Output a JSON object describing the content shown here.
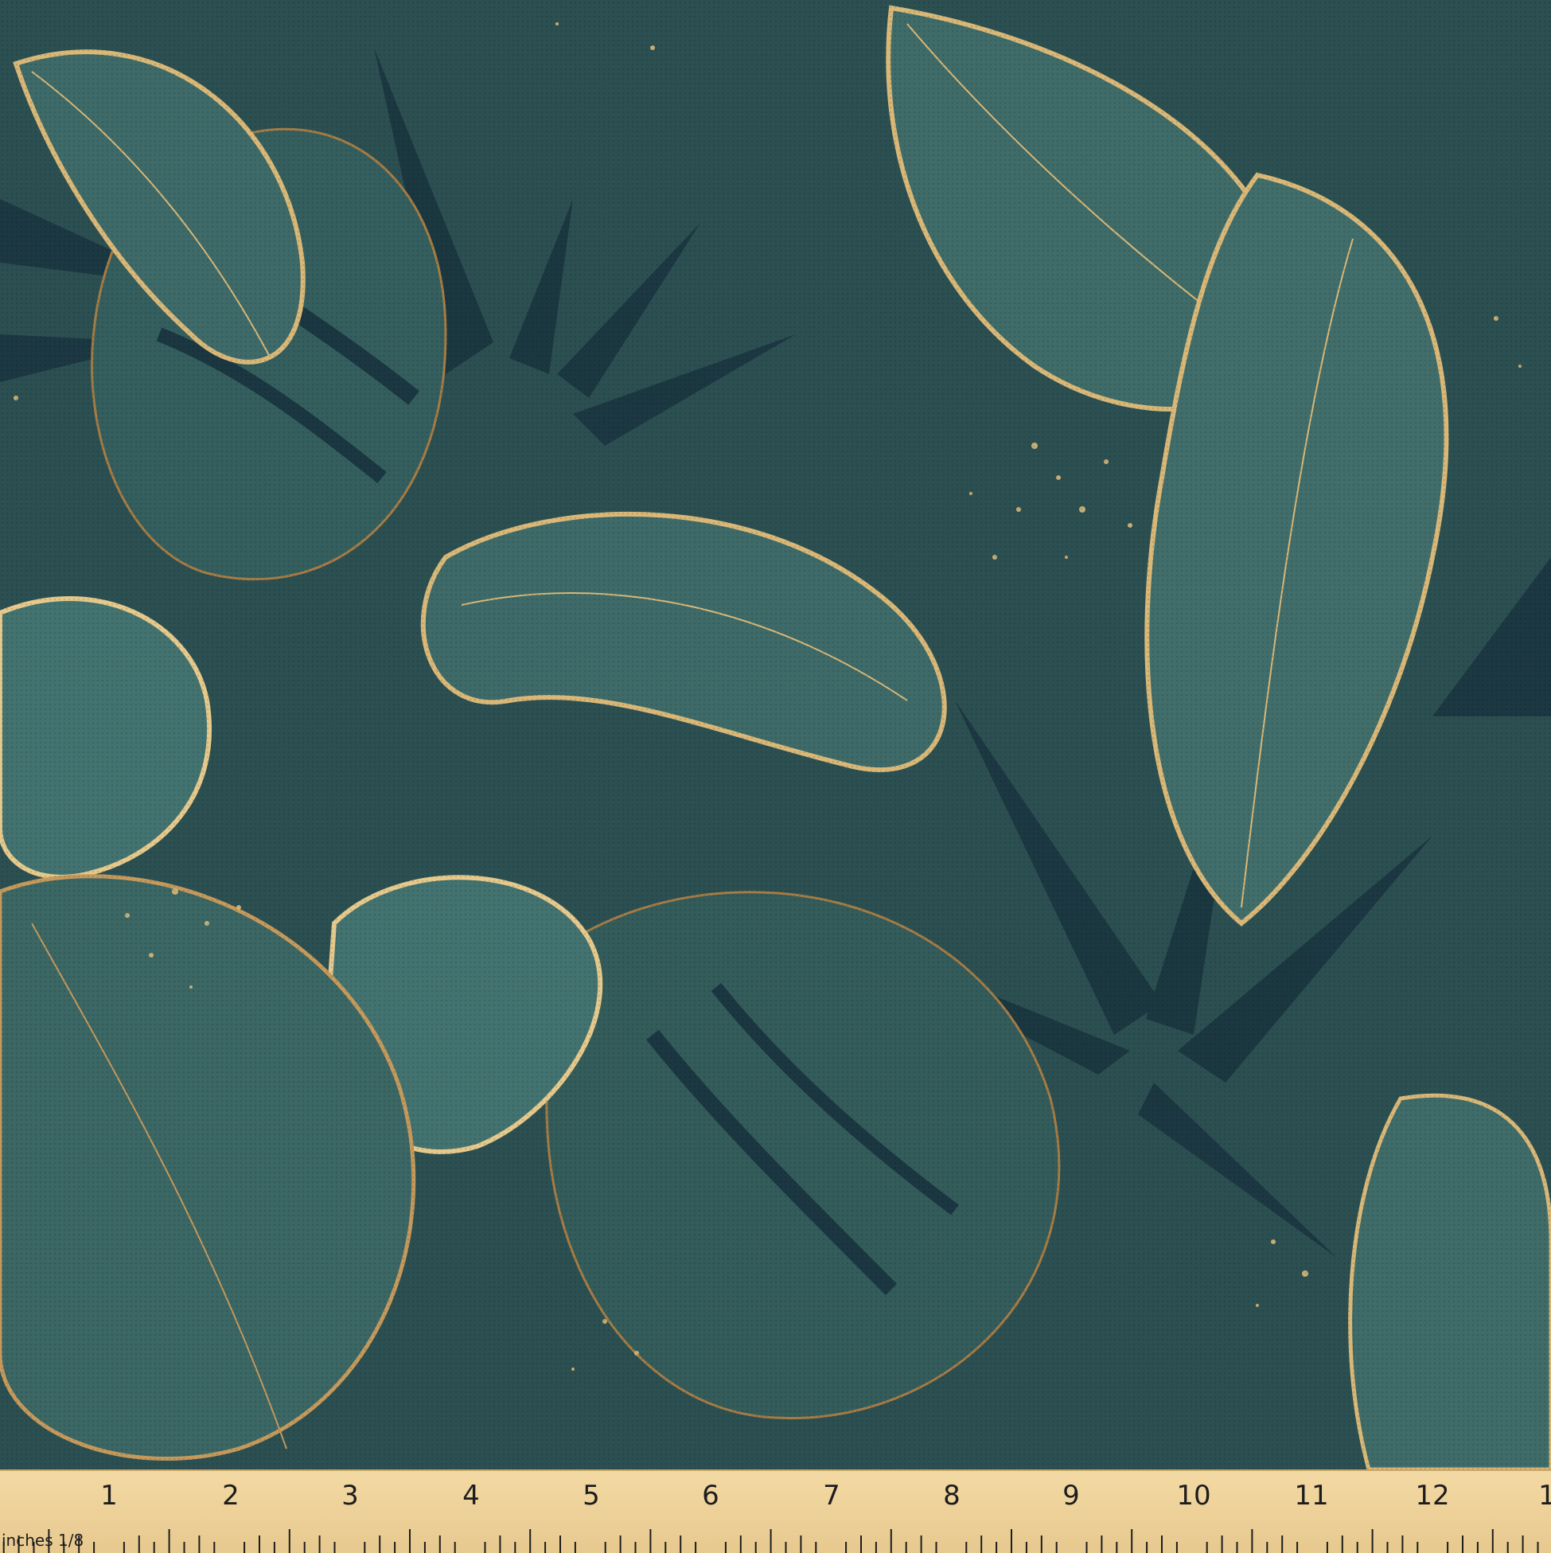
{
  "palette": {
    "background": "#2c5052",
    "leaf_teal": "#3e6b69",
    "leaf_dark": "#1b3741",
    "leaf_light": "#4a7a74",
    "gold": "#d9b878",
    "gold_dark": "#a67c45",
    "ruler": "#f0d59c"
  },
  "ruler": {
    "numbers": [
      "1",
      "2",
      "3",
      "4",
      "5",
      "6",
      "7",
      "8",
      "9",
      "10",
      "11",
      "12",
      "1"
    ],
    "unit_label": "inches 1/8"
  }
}
